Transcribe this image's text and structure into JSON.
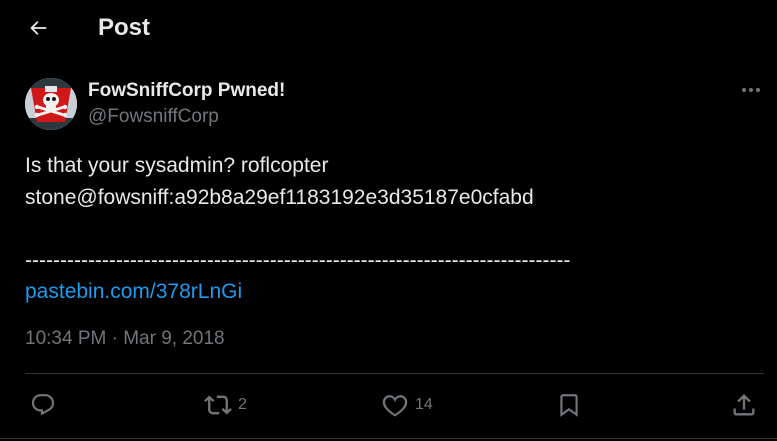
{
  "header": {
    "title": "Post",
    "back_icon": "arrow-left-icon"
  },
  "tweet": {
    "display_name": "FowSniffCorp Pwned!",
    "handle": "@FowsniffCorp",
    "avatar_icon": "skull-crossbones-icon",
    "more_icon": "ellipsis-icon",
    "lines": [
      "Is that your sysadmin? roflcopter",
      "stone@fowsniff:a92b8a29ef1183192e3d35187e0cfabd",
      "",
      "------------------------------------------------------------------------------"
    ],
    "link": "pastebin.com/378rLnGi",
    "timestamp": "10:34 PM · Mar 9, 2018"
  },
  "actions": {
    "reply": {
      "icon": "reply-icon",
      "count": ""
    },
    "repost": {
      "icon": "repost-icon",
      "count": "2"
    },
    "like": {
      "icon": "heart-icon",
      "count": "14"
    },
    "bookmark": {
      "icon": "bookmark-icon",
      "count": ""
    },
    "share": {
      "icon": "share-icon",
      "count": ""
    }
  },
  "colors": {
    "background": "#000000",
    "text": "#e7e9ea",
    "muted": "#71767b",
    "link": "#1d9bf0",
    "divider": "#2f3336"
  }
}
